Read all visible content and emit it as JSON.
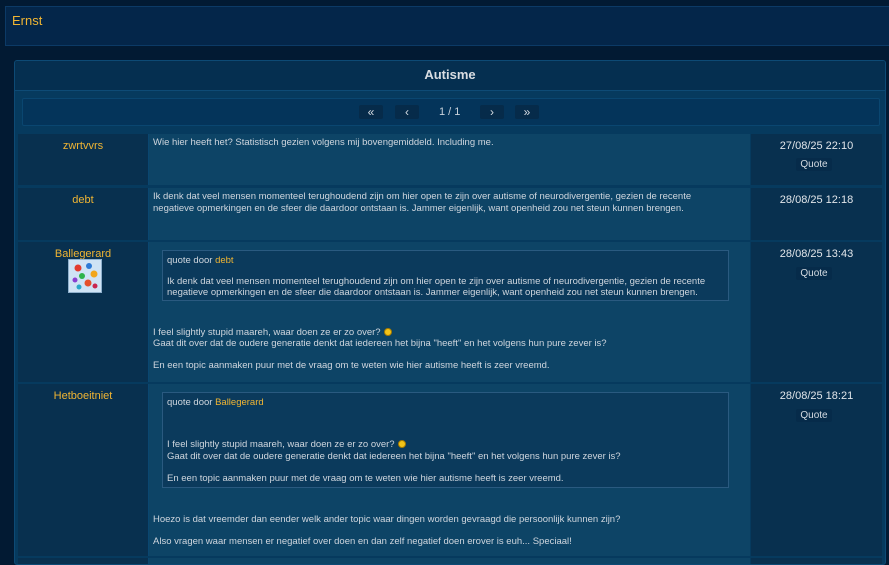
{
  "site": {
    "name": "Ernst"
  },
  "topic": {
    "title": "Autisme"
  },
  "pagination": {
    "first": "«",
    "prev": "‹",
    "info": "1 / 1",
    "next": "›",
    "last": "»"
  },
  "quote_label": "Quote",
  "quote_prefix": "quote door",
  "posts": [
    {
      "author": "zwrtvvrs",
      "timestamp": "27/08/25 22:10",
      "lines": [
        "Wie hier heeft het? Statistisch gezien volgens mij bovengemiddeld. Including me."
      ]
    },
    {
      "author": "debt",
      "timestamp": "28/08/25 12:18",
      "lines": [
        "Ik denk dat veel mensen momenteel terughoudend zijn om hier open te zijn over autisme of neurodivergentie, gezien de recente",
        "negatieve opmerkingen en de sfeer die daardoor ontstaan is. Jammer eigenlijk, want openheid zou net steun kunnen brengen."
      ]
    },
    {
      "author": "Ballegerard",
      "timestamp": "28/08/25 13:43",
      "quote": {
        "author": "debt",
        "lines": [
          "Ik denk dat veel mensen momenteel terughoudend zijn om hier open te zijn over autisme of neurodivergentie, gezien de recente",
          "negatieve opmerkingen en de sfeer die daardoor ontstaan is. Jammer eigenlijk, want openheid zou net steun kunnen brengen."
        ]
      },
      "lines": [
        "I feel slightly stupid maareh, waar doen ze er zo over?",
        "Gaat dit over dat de oudere generatie denkt dat iedereen het bijna \"heeft\" en het volgens hun pure zever is?",
        "En een topic aanmaken puur met de vraag om te weten wie hier autisme heeft is zeer vreemd."
      ]
    },
    {
      "author": "Hetboeitniet",
      "timestamp": "28/08/25 18:21",
      "quote": {
        "author": "Ballegerard",
        "lines": [
          "I feel slightly stupid maareh, waar doen ze er zo over?",
          "Gaat dit over dat de oudere generatie denkt dat iedereen het bijna \"heeft\" en het volgens hun pure zever is?",
          "En een topic aanmaken puur met de vraag om te weten wie hier autisme heeft is zeer vreemd."
        ]
      },
      "lines": [
        "Hoezo is dat vreemder dan eender welk ander topic waar dingen worden gevraagd die persoonlijk kunnen zijn?",
        "Also vragen waar mensen er negatief over doen en dan zelf negatief doen erover is euh... Speciaal!"
      ]
    }
  ]
}
